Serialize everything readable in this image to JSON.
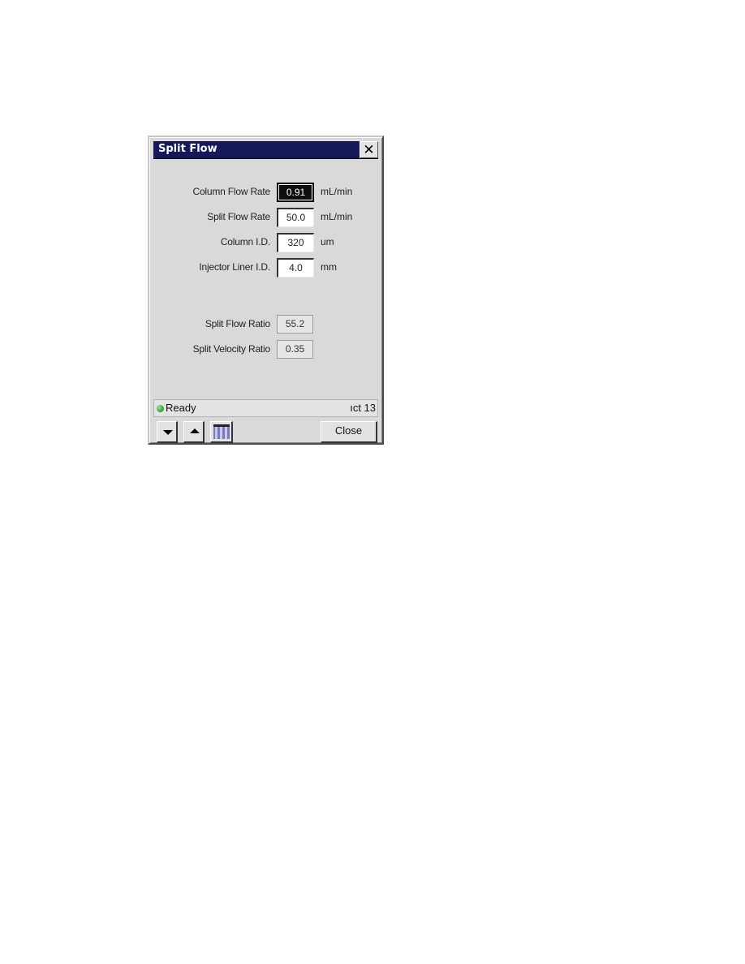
{
  "window": {
    "title": "Split Flow",
    "close_glyph": "✕"
  },
  "inputs": [
    {
      "label": "Column Flow Rate",
      "value": "0.91",
      "unit": "mL/min",
      "selected": true
    },
    {
      "label": "Split Flow Rate",
      "value": "50.0",
      "unit": "mL/min",
      "selected": false
    },
    {
      "label": "Column I.D.",
      "value": "320",
      "unit": "um",
      "selected": false
    },
    {
      "label": "Injector Liner I.D.",
      "value": "4.0",
      "unit": "mm",
      "selected": false
    }
  ],
  "results": [
    {
      "label": "Split Flow Ratio",
      "value": "55.2"
    },
    {
      "label": "Split Velocity Ratio",
      "value": "0.35"
    }
  ],
  "status": {
    "text": "Ready",
    "indicator_color": "#2a9a2a",
    "right_text": "ıct 13"
  },
  "toolbar": {
    "down_icon": "arrow-down",
    "up_icon": "arrow-up",
    "calculator_icon": "calculator",
    "close_label": "Close"
  },
  "colors": {
    "titlebar": "#15195a",
    "dialog_bg": "#d9d9d9"
  }
}
